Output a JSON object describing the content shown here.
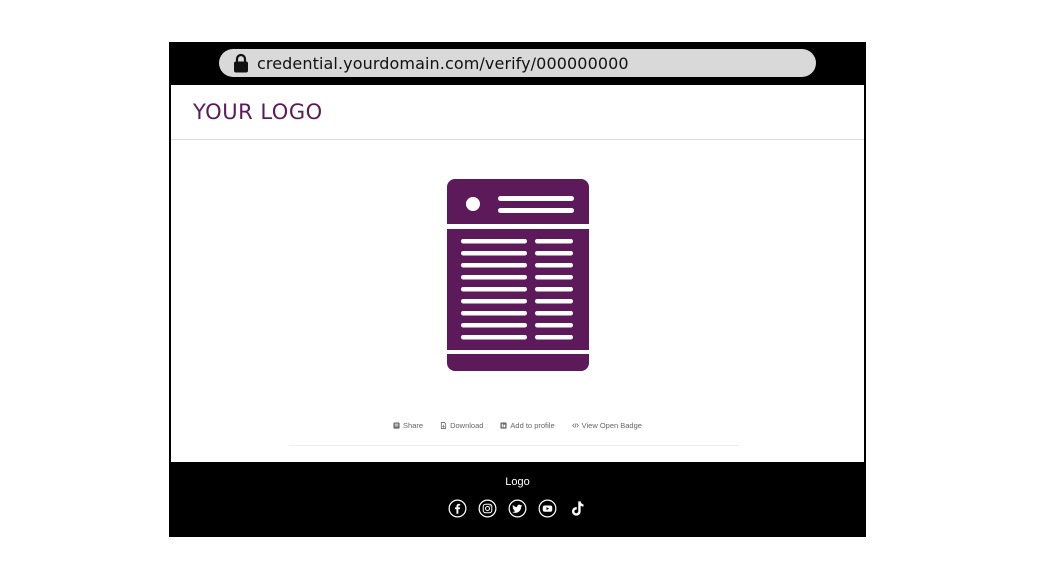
{
  "browser": {
    "url": "credential.yourdomain.com/verify/000000000"
  },
  "header": {
    "logo_text": "YOUR LOGO"
  },
  "badge": {
    "color": "#5c1a5a"
  },
  "actions": [
    {
      "label": "Share",
      "icon": "share-icon"
    },
    {
      "label": "Download",
      "icon": "download-icon"
    },
    {
      "label": "Add to profile",
      "icon": "profile-icon"
    },
    {
      "label": "View Open Badge",
      "icon": "code-icon"
    }
  ],
  "footer": {
    "logo": "Logo",
    "socials": [
      "facebook-icon",
      "instagram-icon",
      "twitter-icon",
      "youtube-icon",
      "tiktok-icon"
    ]
  },
  "colors": {
    "brand": "#5c1a5a",
    "frame": "#000000",
    "urlbar": "#d9d9d9"
  }
}
